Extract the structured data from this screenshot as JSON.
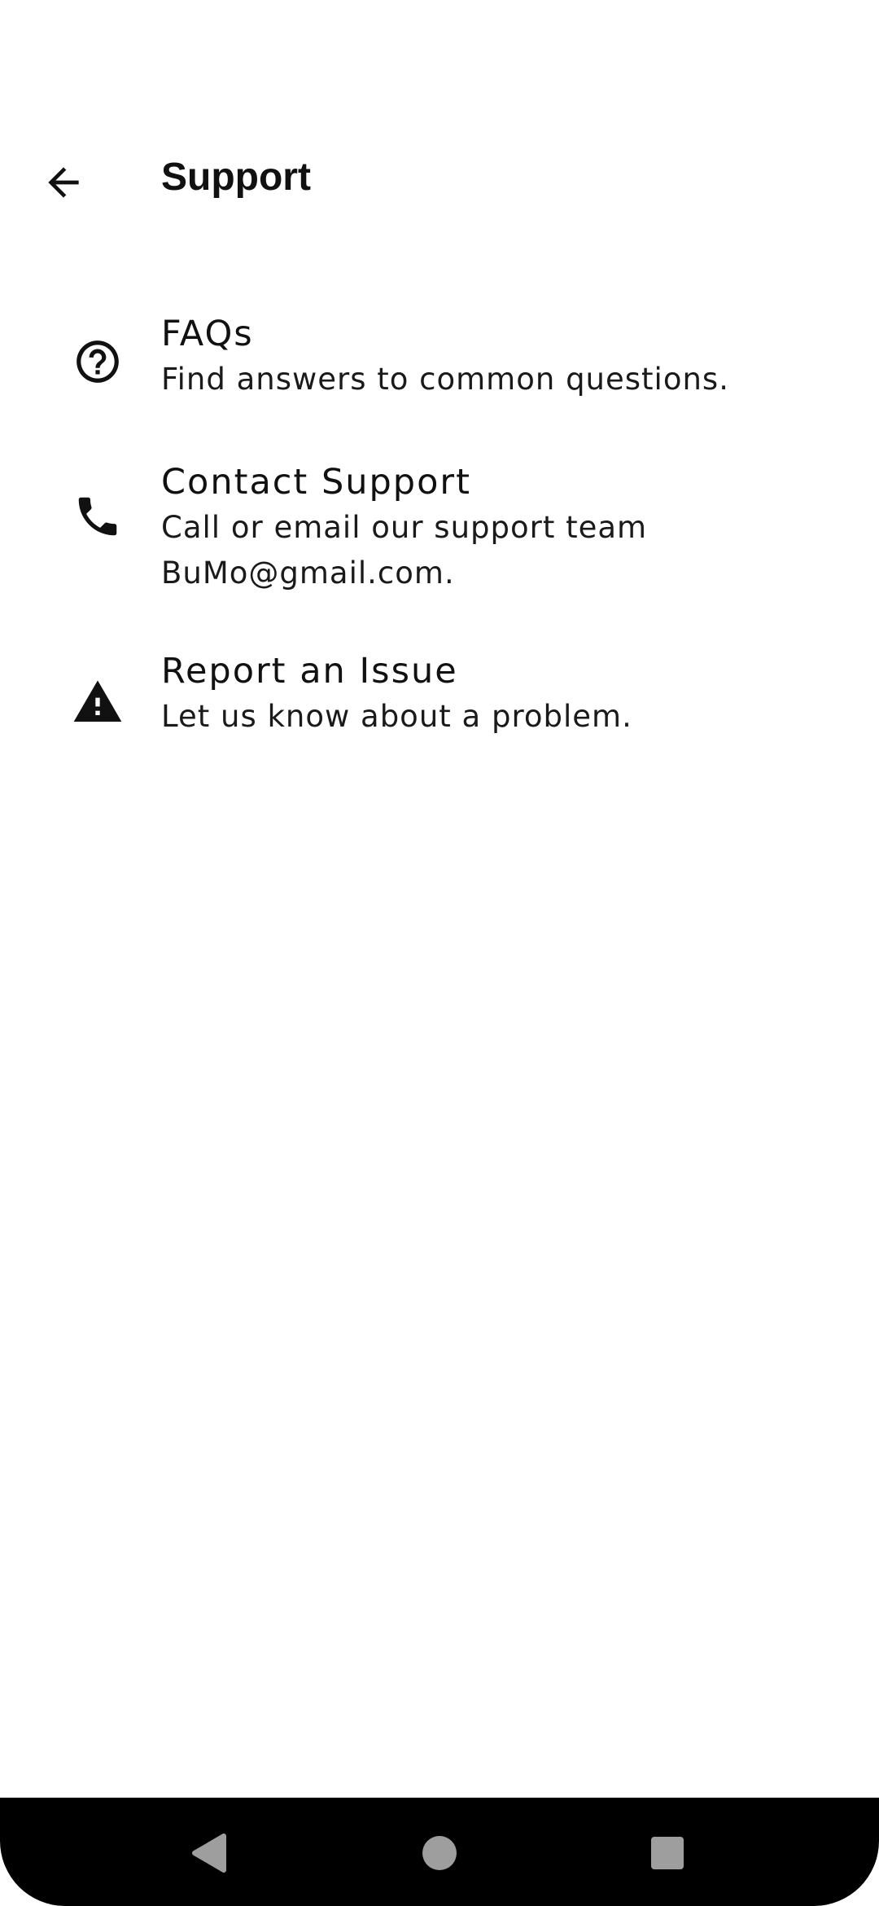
{
  "app_bar": {
    "title": "Support",
    "back_icon": "arrow-back-icon"
  },
  "items": [
    {
      "icon": "help-circle-icon",
      "title": "FAQs",
      "subtitle": "Find answers to common questions."
    },
    {
      "icon": "phone-icon",
      "title": "Contact Support",
      "subtitle": "Call or email our support team\n BuMo@gmail.com."
    },
    {
      "icon": "warning-icon",
      "title": "Report an Issue",
      "subtitle": "Let us know about a problem."
    }
  ],
  "nav_bar": {
    "back_icon": "nav-back-icon",
    "home_icon": "nav-home-icon",
    "recents_icon": "nav-recents-icon",
    "button_color": "#9e9e9e"
  }
}
